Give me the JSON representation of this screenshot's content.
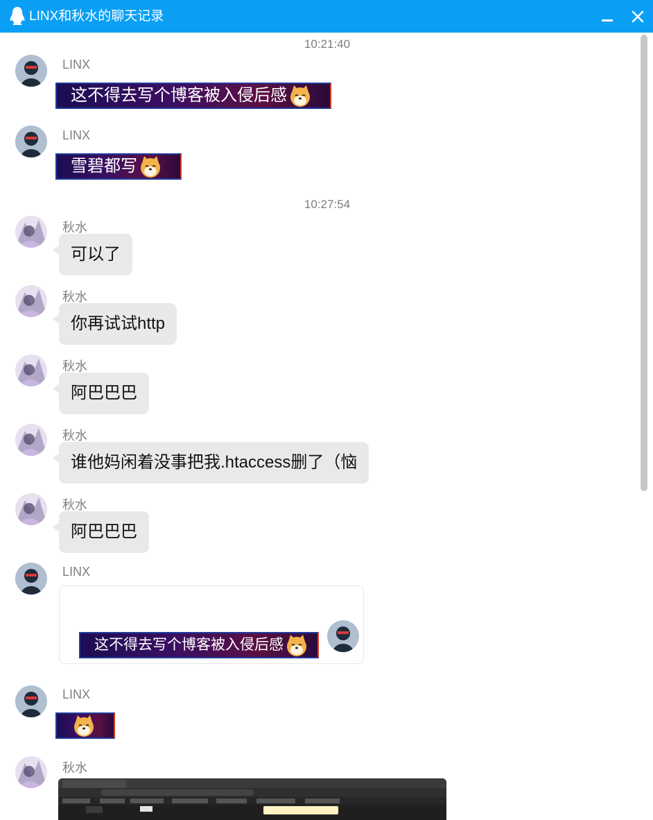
{
  "window": {
    "title": "LINX和秋水的聊天记录",
    "controls": {
      "minimize_icon": "minimize-icon",
      "close_icon": "close-icon"
    }
  },
  "messages": {
    "ts1": "10:21:40",
    "m1": {
      "sender": "LINX",
      "text": "这不得去写个博客被入侵后感"
    },
    "m2": {
      "sender": "LINX",
      "text": "雪碧都写"
    },
    "ts2": "10:27:54",
    "m3": {
      "sender": "秋水",
      "text": "可以了"
    },
    "m4": {
      "sender": "秋水",
      "text": "你再试试http"
    },
    "m5": {
      "sender": "秋水",
      "text": "阿巴巴巴"
    },
    "m6": {
      "sender": "秋水",
      "text": "谁他妈闲着没事把我.htaccess删了（恼"
    },
    "m7": {
      "sender": "秋水",
      "text": "阿巴巴巴"
    },
    "m8": {
      "sender": "LINX",
      "quote_text": "这不得去写个博客被入侵后感"
    },
    "m9": {
      "sender": "LINX"
    },
    "m10": {
      "sender": "秋水",
      "image": "browser-screenshot-thumbnail"
    }
  },
  "colors": {
    "titlebar": "#0a9ff5",
    "bubble": "#e9e9e9",
    "timestamp": "#7c7c7c"
  }
}
